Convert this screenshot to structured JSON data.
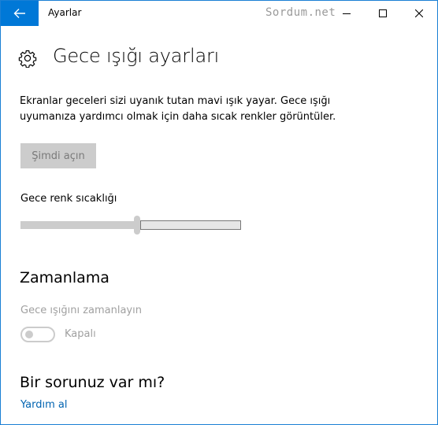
{
  "window": {
    "app_title": "Ayarlar",
    "watermark": "Sordum.net"
  },
  "page": {
    "title": "Gece ışığı ayarları",
    "description": "Ekranlar geceleri sizi uyanık tutan mavi ışık yayar. Gece ışığı uyumanıza yardımcı olmak için daha sıcak renkler görüntüler.",
    "turn_on_label": "Şimdi açın",
    "slider_label": "Gece renk sıcaklığı",
    "slider_value": 0.53
  },
  "schedule": {
    "heading": "Zamanlama",
    "label": "Gece ışığını zamanlayın",
    "toggle_state": "Kapalı",
    "toggle_on": false
  },
  "help": {
    "heading": "Bir sorunuz var mı?",
    "link_label": "Yardım al"
  },
  "colors": {
    "accent": "#0078d7",
    "link": "#0063b1",
    "disabled": "#cccccc"
  }
}
